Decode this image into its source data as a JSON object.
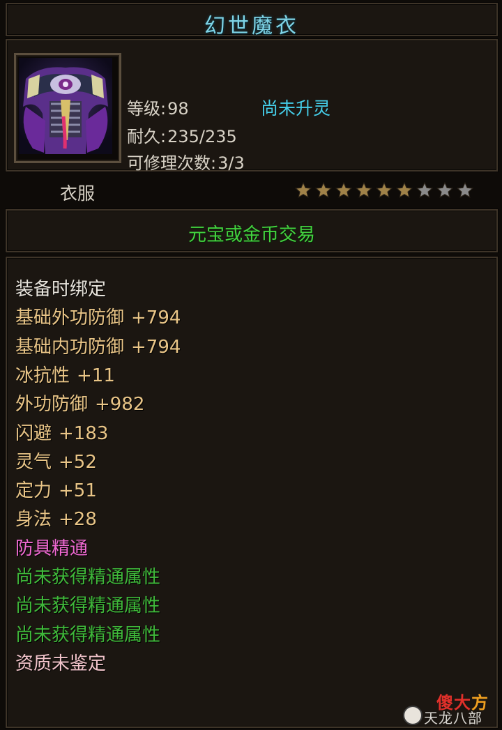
{
  "item": {
    "name": "幻世魔衣",
    "level_label": "等级:",
    "level_value": "98",
    "spirit_status": "尚未升灵",
    "durability_label": "耐久:",
    "durability_value": "235/235",
    "repair_label": "可修理次数:",
    "repair_value": "3/3",
    "type": "衣服",
    "icon": "robe-armor-icon",
    "stars": {
      "filled": 6,
      "total": 9
    },
    "trade": "元宝或金币交易"
  },
  "attributes": [
    {
      "label": "装备时绑定",
      "value": "",
      "color": "white"
    },
    {
      "label": "基础外功防御",
      "value": "+794",
      "color": "gold"
    },
    {
      "label": "基础内功防御",
      "value": "+794",
      "color": "gold"
    },
    {
      "label": "冰抗性",
      "value": "+11",
      "color": "gold"
    },
    {
      "label": "外功防御",
      "value": "+982",
      "color": "gold"
    },
    {
      "label": "闪避",
      "value": "+183",
      "color": "gold"
    },
    {
      "label": "灵气",
      "value": "+52",
      "color": "gold"
    },
    {
      "label": "定力",
      "value": "+51",
      "color": "gold"
    },
    {
      "label": "身法",
      "value": "+28",
      "color": "gold"
    },
    {
      "label": "防具精通",
      "value": "",
      "color": "pink"
    },
    {
      "label": "尚未获得精通属性",
      "value": "",
      "color": "green"
    },
    {
      "label": "尚未获得精通属性",
      "value": "",
      "color": "green"
    },
    {
      "label": "尚未获得精通属性",
      "value": "",
      "color": "green"
    },
    {
      "label": "资质未鉴定",
      "value": "",
      "color": "rose"
    }
  ],
  "colors": {
    "title": "#7fd4e6",
    "spirit": "#45cde8",
    "trade": "#43d23f",
    "star_filled": "#a08248",
    "star_empty": "#8a8a8a"
  },
  "watermark": {
    "logo": "傻大方",
    "sub": "天龙八部"
  }
}
